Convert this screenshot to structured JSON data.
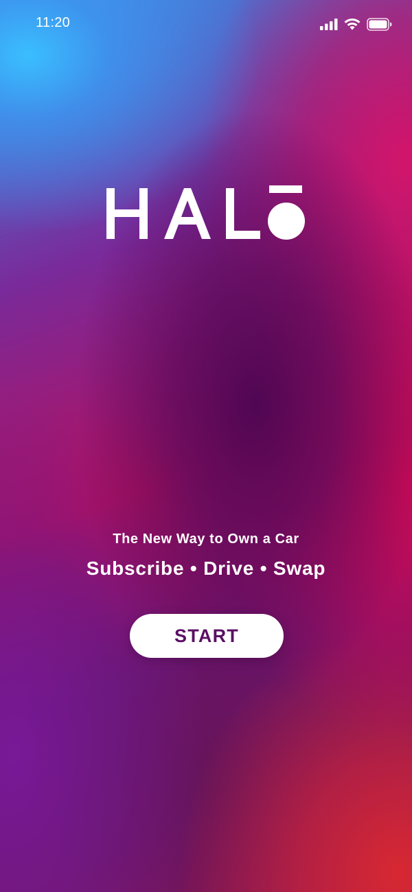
{
  "status_bar": {
    "time": "11:20",
    "icons": [
      "cellular-signal-icon",
      "wifi-icon",
      "battery-icon"
    ]
  },
  "logo": {
    "text": "HALŌ"
  },
  "hero": {
    "tagline": "The New Way to Own a Car",
    "subtitle": "Subscribe • Drive • Swap"
  },
  "actions": {
    "start_label": "START"
  },
  "colors": {
    "button_text": "#5b0f64",
    "button_background": "#ffffff",
    "text": "#ffffff"
  }
}
